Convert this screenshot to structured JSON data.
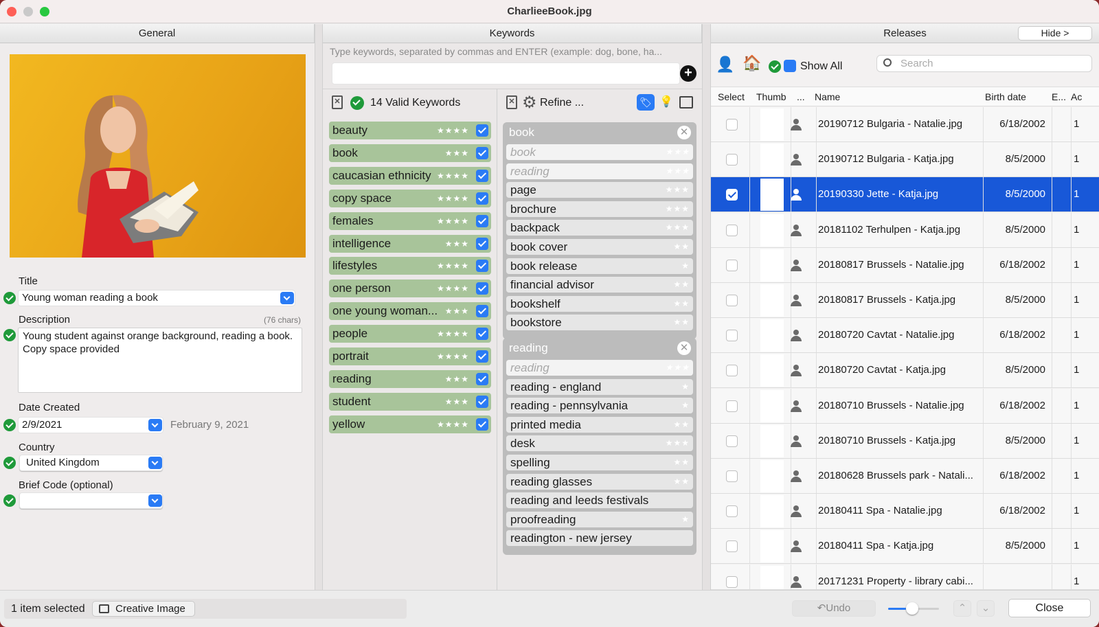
{
  "window": {
    "title": "CharlieeBook.jpg"
  },
  "general": {
    "header": "General",
    "title_label": "Title",
    "title_value": "Young woman reading a book",
    "description_label": "Description",
    "description_count": "(76 chars)",
    "description_value": "Young student against orange background, reading a book. Copy space provided",
    "date_label": "Date Created",
    "date_value": "2/9/2021",
    "date_long": "February 9, 2021",
    "country_label": "Country",
    "country_value": "United Kingdom",
    "brief_label": "Brief Code (optional)",
    "brief_value": ""
  },
  "keywords": {
    "header": "Keywords",
    "placeholder": "Type keywords, separated by commas and ENTER (example: dog, bone, ha...",
    "valid_label": "14 Valid Keywords",
    "refine_label": "Refine ...",
    "items": [
      {
        "text": "beauty",
        "stars": "★★★★"
      },
      {
        "text": "book",
        "stars": "★★★"
      },
      {
        "text": "caucasian ethnicity",
        "stars": "★★★★"
      },
      {
        "text": "copy space",
        "stars": "★★★★"
      },
      {
        "text": "females",
        "stars": "★★★★"
      },
      {
        "text": "intelligence",
        "stars": "★★★"
      },
      {
        "text": "lifestyles",
        "stars": "★★★★"
      },
      {
        "text": "one person",
        "stars": "★★★★"
      },
      {
        "text": "one young woman...",
        "stars": "★★★"
      },
      {
        "text": "people",
        "stars": "★★★★"
      },
      {
        "text": "portrait",
        "stars": "★★★★"
      },
      {
        "text": "reading",
        "stars": "★★★"
      },
      {
        "text": "student",
        "stars": "★★★"
      },
      {
        "text": "yellow",
        "stars": "★★★★"
      }
    ],
    "groups": [
      {
        "title": "book",
        "items": [
          {
            "text": "book",
            "stars": "★★★",
            "used": true
          },
          {
            "text": "reading",
            "stars": "★★★",
            "used": true
          },
          {
            "text": "page",
            "stars": "★★★",
            "used": false
          },
          {
            "text": "brochure",
            "stars": "★★★",
            "used": false
          },
          {
            "text": "backpack",
            "stars": "★★★",
            "used": false
          },
          {
            "text": "book cover",
            "stars": "★★",
            "used": false
          },
          {
            "text": "book release",
            "stars": "★",
            "used": false
          },
          {
            "text": "financial advisor",
            "stars": "★★",
            "used": false
          },
          {
            "text": "bookshelf",
            "stars": "★★",
            "used": false
          },
          {
            "text": "bookstore",
            "stars": "★★",
            "used": false
          }
        ]
      },
      {
        "title": "reading",
        "items": [
          {
            "text": "reading",
            "stars": "★★★",
            "used": true
          },
          {
            "text": "reading - england",
            "stars": "★",
            "used": false
          },
          {
            "text": "reading - pennsylvania",
            "stars": "★",
            "used": false
          },
          {
            "text": "printed media",
            "stars": "★★",
            "used": false
          },
          {
            "text": "desk",
            "stars": "★★★",
            "used": false
          },
          {
            "text": "spelling",
            "stars": "★★",
            "used": false
          },
          {
            "text": "reading glasses",
            "stars": "★★",
            "used": false
          },
          {
            "text": "reading and leeds festivals",
            "stars": "",
            "used": false
          },
          {
            "text": "proofreading",
            "stars": "★",
            "used": false
          },
          {
            "text": "readington - new jersey",
            "stars": "",
            "used": false
          }
        ]
      }
    ]
  },
  "releases": {
    "header": "Releases",
    "hide_label": "Hide >",
    "show_all": "Show All",
    "search_placeholder": "Search",
    "columns": [
      "Select",
      "Thumb",
      "...",
      "Name",
      "Birth date",
      "E...",
      "Ac"
    ],
    "rows": [
      {
        "name": "20190712 Bulgaria - Natalie.jpg",
        "birth": "6/18/2002",
        "ac": "1",
        "selected": false
      },
      {
        "name": "20190712 Bulgaria - Katja.jpg",
        "birth": "8/5/2000",
        "ac": "1",
        "selected": false
      },
      {
        "name": "20190330 Jette - Katja.jpg",
        "birth": "8/5/2000",
        "ac": "1",
        "selected": true
      },
      {
        "name": "20181102 Terhulpen - Katja.jpg",
        "birth": "8/5/2000",
        "ac": "1",
        "selected": false
      },
      {
        "name": "20180817 Brussels - Natalie.jpg",
        "birth": "6/18/2002",
        "ac": "1",
        "selected": false
      },
      {
        "name": "20180817 Brussels - Katja.jpg",
        "birth": "8/5/2000",
        "ac": "1",
        "selected": false
      },
      {
        "name": "20180720 Cavtat - Natalie.jpg",
        "birth": "6/18/2002",
        "ac": "1",
        "selected": false
      },
      {
        "name": "20180720 Cavtat - Katja.jpg",
        "birth": "8/5/2000",
        "ac": "1",
        "selected": false
      },
      {
        "name": "20180710 Brussels - Natalie.jpg",
        "birth": "6/18/2002",
        "ac": "1",
        "selected": false
      },
      {
        "name": "20180710 Brussels - Katja.jpg",
        "birth": "8/5/2000",
        "ac": "1",
        "selected": false
      },
      {
        "name": "20180628 Brussels park - Natali...",
        "birth": "6/18/2002",
        "ac": "1",
        "selected": false
      },
      {
        "name": "20180411 Spa - Natalie.jpg",
        "birth": "6/18/2002",
        "ac": "1",
        "selected": false
      },
      {
        "name": "20180411 Spa - Katja.jpg",
        "birth": "8/5/2000",
        "ac": "1",
        "selected": false
      },
      {
        "name": "20171231 Property - library cabi...",
        "birth": "",
        "ac": "1",
        "selected": false
      }
    ]
  },
  "footer": {
    "selected": "1 item selected",
    "creative": "Creative Image",
    "undo": "Undo",
    "close": "Close"
  }
}
